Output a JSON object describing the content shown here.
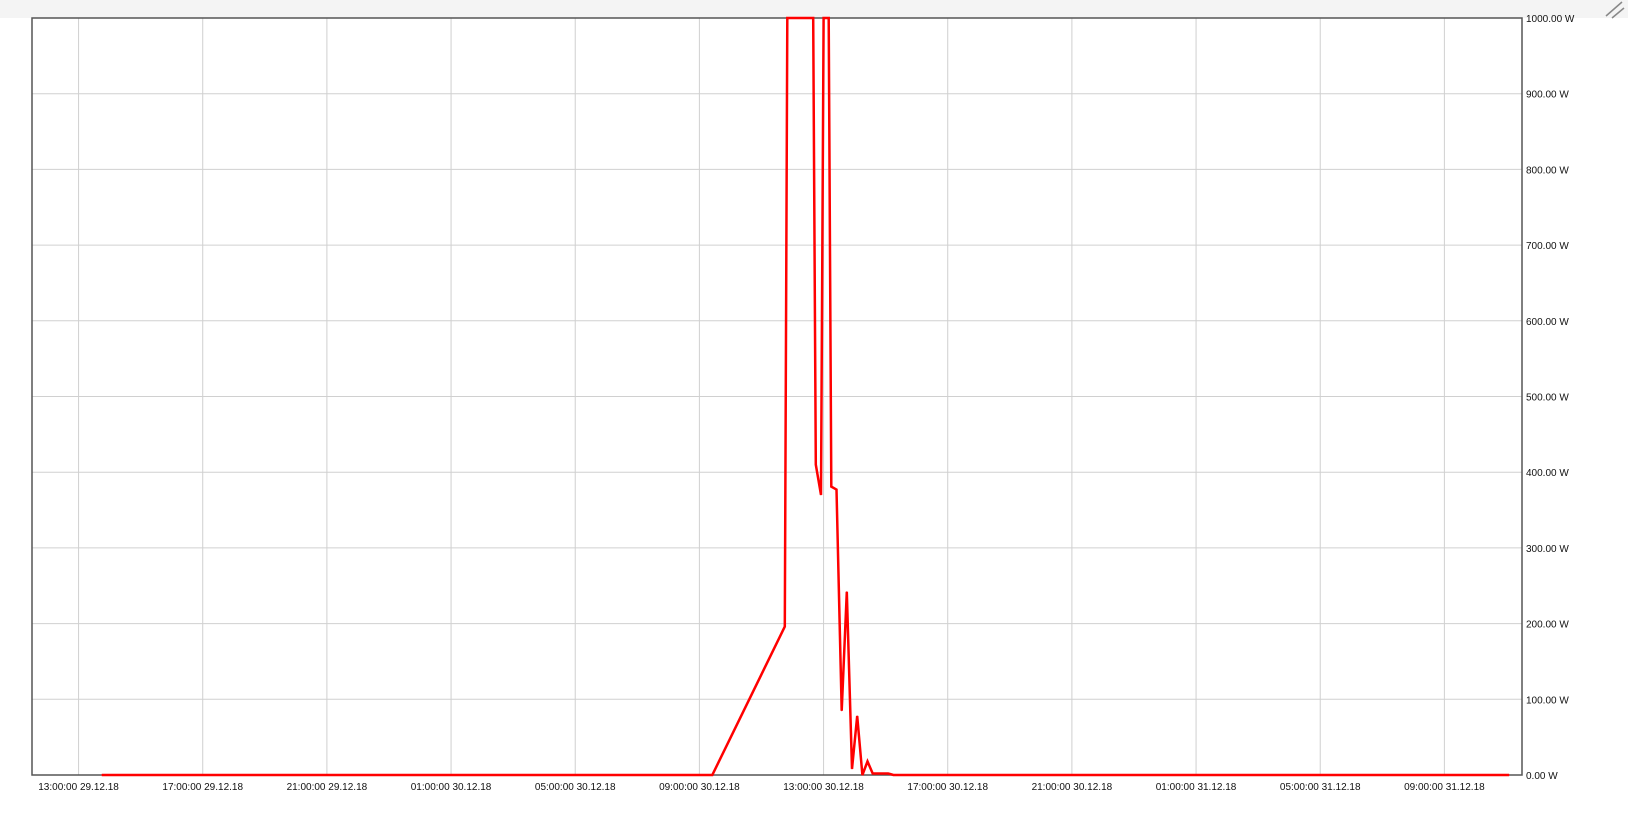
{
  "chart_data": {
    "type": "line",
    "x_ticks": [
      "13:00:00 29.12.18",
      "17:00:00 29.12.18",
      "21:00:00 29.12.18",
      "01:00:00 30.12.18",
      "05:00:00 30.12.18",
      "09:00:00 30.12.18",
      "13:00:00 30.12.18",
      "17:00:00 30.12.18",
      "21:00:00 30.12.18",
      "01:00:00 31.12.18",
      "05:00:00 31.12.18",
      "09:00:00 31.12.18"
    ],
    "x_range": [
      "2018-12-29 11:30",
      "2018-12-31 11:30"
    ],
    "y_ticks": [
      "1000.00 W",
      "900.00 W",
      "800.00 W",
      "700.00 W",
      "600.00 W",
      "500.00 W",
      "400.00 W",
      "300.00 W",
      "200.00 W",
      "100.00 W",
      "0.00 W"
    ],
    "ylim": [
      0,
      1000
    ],
    "grid": true,
    "series": [
      {
        "color": "#ff0000",
        "points": [
          {
            "x": "2018-12-29 13:45",
            "y": 0
          },
          {
            "x": "2018-12-30 09:25",
            "y": 0
          },
          {
            "x": "2018-12-30 11:45",
            "y": 196
          },
          {
            "x": "2018-12-30 11:50",
            "y": 1000
          },
          {
            "x": "2018-12-30 12:40",
            "y": 1000
          },
          {
            "x": "2018-12-30 12:45",
            "y": 410
          },
          {
            "x": "2018-12-30 12:55",
            "y": 370
          },
          {
            "x": "2018-12-30 13:00",
            "y": 1000
          },
          {
            "x": "2018-12-30 13:10",
            "y": 1000
          },
          {
            "x": "2018-12-30 13:15",
            "y": 381
          },
          {
            "x": "2018-12-30 13:25",
            "y": 377
          },
          {
            "x": "2018-12-30 13:35",
            "y": 85
          },
          {
            "x": "2018-12-30 13:45",
            "y": 242
          },
          {
            "x": "2018-12-30 13:55",
            "y": 8
          },
          {
            "x": "2018-12-30 14:05",
            "y": 78
          },
          {
            "x": "2018-12-30 14:15",
            "y": 0
          },
          {
            "x": "2018-12-30 14:25",
            "y": 18
          },
          {
            "x": "2018-12-30 14:35",
            "y": 2
          },
          {
            "x": "2018-12-30 15:05",
            "y": 2
          },
          {
            "x": "2018-12-30 15:15",
            "y": 0
          },
          {
            "x": "2018-12-31 11:05",
            "y": 0
          }
        ]
      }
    ]
  }
}
